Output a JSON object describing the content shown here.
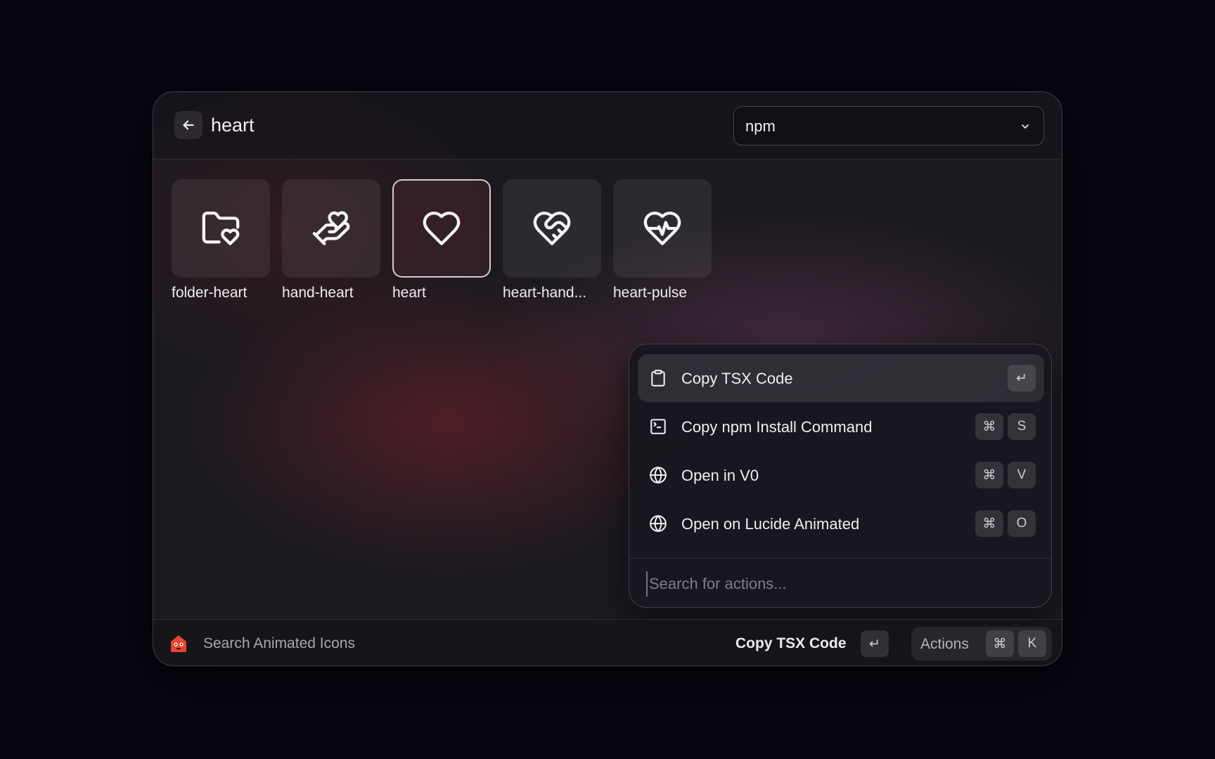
{
  "header": {
    "query": "heart",
    "package_manager": "npm"
  },
  "icons": [
    {
      "label": "folder-heart",
      "icon": "folder-heart-icon",
      "selected": false
    },
    {
      "label": "hand-heart",
      "icon": "hand-heart-icon",
      "selected": false
    },
    {
      "label": "heart",
      "icon": "heart-icon",
      "selected": true
    },
    {
      "label": "heart-hand...",
      "icon": "heart-handshake-icon",
      "selected": false
    },
    {
      "label": "heart-pulse",
      "icon": "heart-pulse-icon",
      "selected": false
    }
  ],
  "actions_panel": {
    "items": [
      {
        "label": "Copy TSX Code",
        "icon": "clipboard-icon",
        "keys": [
          "↵"
        ]
      },
      {
        "label": "Copy npm Install Command",
        "icon": "terminal-square-icon",
        "keys": [
          "⌘",
          "S"
        ]
      },
      {
        "label": "Open in V0",
        "icon": "globe-icon",
        "keys": [
          "⌘",
          "V"
        ]
      },
      {
        "label": "Open on Lucide Animated",
        "icon": "globe-icon",
        "keys": [
          "⌘",
          "O"
        ]
      }
    ],
    "search_placeholder": "Search for actions..."
  },
  "footer": {
    "title": "Search Animated Icons",
    "primary_action": "Copy TSX Code",
    "primary_key": "↵",
    "actions_label": "Actions",
    "actions_keys": [
      "⌘",
      "K"
    ]
  },
  "colors": {
    "background": "#07050f",
    "window": "#1c1a20",
    "logo_accent": "#e8452c"
  }
}
